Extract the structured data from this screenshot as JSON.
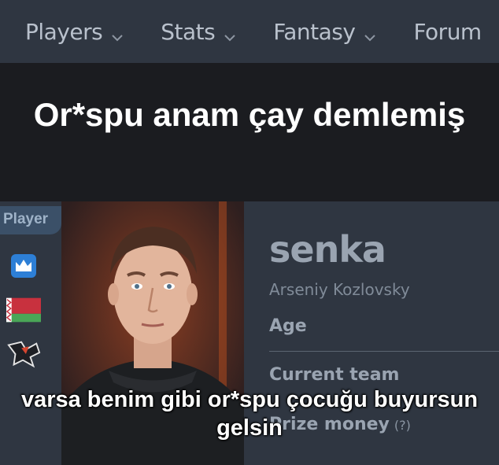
{
  "nav": {
    "items": [
      {
        "label": "Players"
      },
      {
        "label": "Stats"
      },
      {
        "label": "Fantasy"
      },
      {
        "label": "Forum"
      }
    ]
  },
  "meme": {
    "top_text": "Or*spu anam çay demlemiş",
    "bottom_text": "varsa benim gibi or*spu çocuğu buyursun gelsin"
  },
  "sidebar": {
    "tab_label": "Player",
    "icons": [
      "crown-icon",
      "belarus-flag-icon",
      "team-logo-icon"
    ]
  },
  "player": {
    "nickname": "senka",
    "real_name": "Arseniy Kozlovsky",
    "age_label": "Age",
    "team_label": "Current team",
    "prize_label": "Prize money",
    "help_label": "(?)"
  },
  "colors": {
    "nav_bg": "#2f3641",
    "caption_bg": "#1b1c20",
    "tab_bg": "#3b5068",
    "crown_blue": "#2d7fd6",
    "flag_red": "#c8313e",
    "flag_green": "#4aa657"
  }
}
